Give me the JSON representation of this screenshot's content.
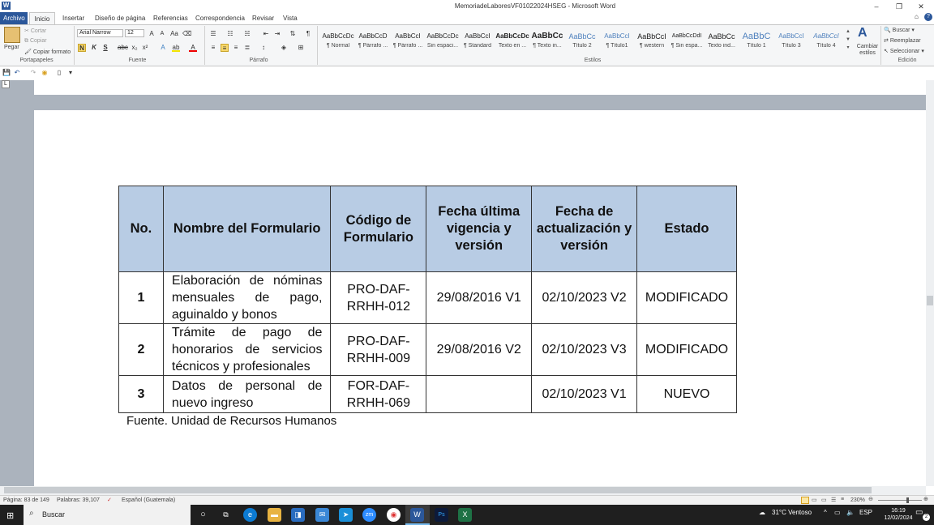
{
  "window": {
    "app_icon": "W",
    "title": "MemoriadeLaboresVF01022024HSEG - Microsoft Word",
    "minimize_icon": "minimize-icon",
    "restore_icon": "restore-icon",
    "close_icon": "close-icon"
  },
  "ribbon": {
    "tabs": [
      "Archivo",
      "Inicio",
      "Insertar",
      "Diseño de página",
      "Referencias",
      "Correspondencia",
      "Revisar",
      "Vista"
    ],
    "clipboard": {
      "paste": "Pegar",
      "cut": "Cortar",
      "copy": "Copiar",
      "format_painter": "Copiar formato",
      "group": "Portapapeles"
    },
    "font": {
      "family": "Arial Narrow",
      "size": "12",
      "group": "Fuente"
    },
    "paragraph": {
      "group": "Párrafo"
    },
    "styles": {
      "items": [
        {
          "preview": "AaBbCcDc",
          "label": "¶ Normal"
        },
        {
          "preview": "AaBbCcD",
          "label": "¶ Párrafo ..."
        },
        {
          "preview": "AaBbCcI",
          "label": "¶ Párrafo ..."
        },
        {
          "preview": "AaBbCcDc",
          "label": "Sin espaci..."
        },
        {
          "preview": "AaBbCcI",
          "label": "¶ Standard"
        },
        {
          "preview": "AaBbCcDc",
          "label": "Texto en ..."
        },
        {
          "preview": "AaBbCc",
          "label": "¶ Texto in..."
        },
        {
          "preview": "AaBbCc",
          "label": "Título 2"
        },
        {
          "preview": "AaBbCcI",
          "label": "¶ Título1"
        },
        {
          "preview": "AaBbCcI",
          "label": "¶ western"
        },
        {
          "preview": "AaBbCcDdI",
          "label": "¶ Sin espa..."
        },
        {
          "preview": "AaBbCc",
          "label": "Texto ind..."
        },
        {
          "preview": "AaBbC",
          "label": "Título 1"
        },
        {
          "preview": "AaBbCcI",
          "label": "Título 3"
        },
        {
          "preview": "AaBbCcI",
          "label": "Título 4"
        }
      ],
      "change_styles": "Cambiar estilos",
      "group": "Estilos"
    },
    "editing": {
      "find": "Buscar",
      "replace": "Reemplazar",
      "select": "Seleccionar",
      "group": "Edición"
    }
  },
  "ruler_tab": "L",
  "document": {
    "table": {
      "headers": [
        "No.",
        "Nombre del Formulario",
        "Código de Formulario",
        "Fecha última vigencia y versión",
        "Fecha de actualización y versión",
        "Estado"
      ],
      "rows": [
        [
          "1",
          "Elaboración de nóminas mensuales de pago, aguinaldo y bonos",
          "PRO-DAF-RRHH-012",
          "29/08/2016 V1",
          "02/10/2023 V2",
          "MODIFICADO"
        ],
        [
          "2",
          "Trámite de pago de honorarios de servicios técnicos y profesionales",
          "PRO-DAF-RRHH-009",
          "29/08/2016 V2",
          "02/10/2023 V3",
          "MODIFICADO"
        ],
        [
          "3",
          "Datos de personal de nuevo ingreso",
          "FOR-DAF-RRHH-069",
          "",
          "02/10/2023 V1",
          "NUEVO"
        ]
      ]
    },
    "source": "Fuente.  Unidad de Recursos Humanos"
  },
  "status": {
    "page": "Página: 83 de 149",
    "words": "Palabras: 39,107",
    "language": "Español (Guatemala)",
    "zoom": "230%"
  },
  "taskbar": {
    "search": "Buscar",
    "weather": "31°C  Ventoso",
    "lang": "ESP",
    "time": "16:19",
    "date": "12/02/2024",
    "notifications": "2"
  },
  "colors": {
    "header_fill": "#b8cce4",
    "word_blue": "#2b579a",
    "doc_bg": "#abb3bd"
  }
}
